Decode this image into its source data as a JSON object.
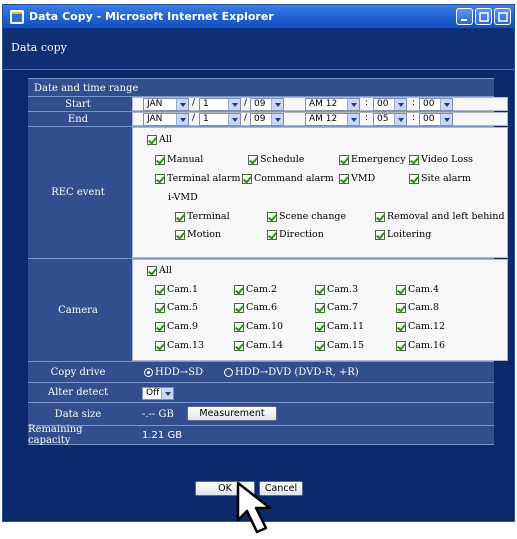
{
  "window": {
    "title": "Data Copy - Microsoft Internet Explorer"
  },
  "page": {
    "heading": "Data copy"
  },
  "section": {
    "title": "Date and time range"
  },
  "start": {
    "label": "Start",
    "month": "JAN",
    "day": "1",
    "year": "09",
    "ampm": "AM 12",
    "min": "00",
    "sec": "00"
  },
  "end": {
    "label": "End",
    "month": "JAN",
    "day": "1",
    "year": "09",
    "ampm": "AM 12",
    "min": "05",
    "sec": "00"
  },
  "rec_event": {
    "label": "REC event",
    "all": "All",
    "items": [
      "Manual",
      "Schedule",
      "Emergency",
      "Video Loss",
      "Terminal alarm",
      "Command alarm",
      "VMD",
      "Site alarm"
    ],
    "ivmd_label": "i-VMD",
    "ivmd_items": [
      "Terminal",
      "Scene change",
      "Removal and left behind",
      "Motion",
      "Direction",
      "Loitering"
    ]
  },
  "camera": {
    "label": "Camera",
    "all": "All",
    "items": [
      "Cam.1",
      "Cam.2",
      "Cam.3",
      "Cam.4",
      "Cam.5",
      "Cam.6",
      "Cam.7",
      "Cam.8",
      "Cam.9",
      "Cam.10",
      "Cam.11",
      "Cam.12",
      "Cam.13",
      "Cam.14",
      "Cam.15",
      "Cam.16"
    ]
  },
  "copy_drive": {
    "label": "Copy drive",
    "opt1": "HDD→SD",
    "opt2": "HDD→DVD (DVD-R, +R)"
  },
  "alter_detect": {
    "label": "Alter detect",
    "value": "Off"
  },
  "data_size": {
    "label": "Data size",
    "value": "-.-- GB",
    "button": "Measurement"
  },
  "remaining": {
    "label": "Remaining capacity",
    "value": "1.21 GB"
  },
  "buttons": {
    "ok": "OK",
    "cancel": "Cancel"
  },
  "colors": {
    "window_bg": "#0a2a6b",
    "row_bg": "#324e8e",
    "title_blue": "#1d5fd0",
    "check_green": "#2d8a1f"
  },
  "icons": {
    "app": "ie-icon",
    "minimize": "minimize-icon",
    "maximize": "maximize-icon",
    "close": "close-icon",
    "pointer": "mouse-pointer-icon"
  }
}
